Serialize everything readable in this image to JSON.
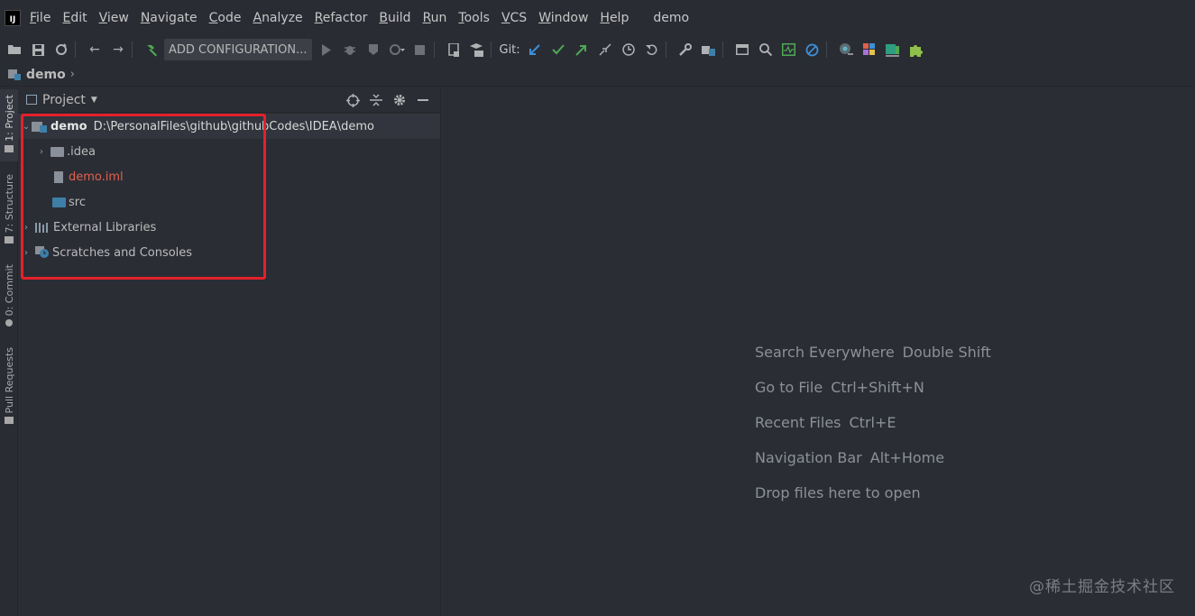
{
  "menu": {
    "items": [
      "File",
      "Edit",
      "View",
      "Navigate",
      "Code",
      "Analyze",
      "Refactor",
      "Build",
      "Run",
      "Tools",
      "VCS",
      "Window",
      "Help"
    ],
    "project_title": "demo",
    "logo_text": "IJ"
  },
  "toolbar": {
    "config_label": "ADD CONFIGURATION...",
    "git_label": "Git:"
  },
  "breadcrumb": {
    "label": "demo",
    "separator": "›"
  },
  "toolstrip": {
    "tabs": [
      "1: Project",
      "7: Structure",
      "0: Commit",
      "Pull Requests"
    ]
  },
  "project_panel": {
    "title": "Project",
    "tree": {
      "root_name": "demo",
      "root_path": "D:\\PersonalFiles\\github\\githubCodes\\IDEA\\demo",
      "idea_folder": ".idea",
      "iml_file": "demo.iml",
      "src_folder": "src",
      "external_libraries": "External Libraries",
      "scratches": "Scratches and Consoles"
    }
  },
  "editor": {
    "hints": [
      {
        "action": "Search Everywhere",
        "key": "Double Shift"
      },
      {
        "action": "Go to File",
        "key": "Ctrl+Shift+N"
      },
      {
        "action": "Recent Files",
        "key": "Ctrl+E"
      },
      {
        "action": "Navigation Bar",
        "key": "Alt+Home"
      },
      {
        "action": "Drop files here to open",
        "key": ""
      }
    ]
  },
  "watermark": "@稀土掘金技术社区",
  "colors": {
    "highlight_box": "#e5202a",
    "modified_file": "#e0614e",
    "source_folder": "#3e7fa8"
  }
}
